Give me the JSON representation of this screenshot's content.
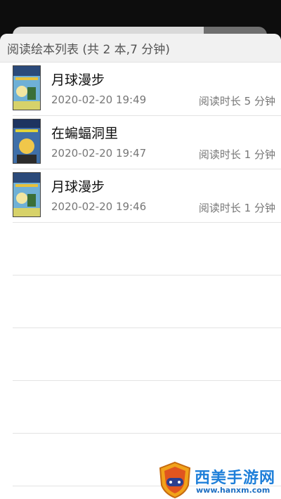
{
  "header": {
    "title": "阅读绘本列表 (共 2 本,7 分钟)"
  },
  "records": [
    {
      "title": "月球漫步",
      "date": "2020-02-20 19:49",
      "duration": "阅读时长 5 分钟",
      "cover": "cover-icon"
    },
    {
      "title": "在蝙蝠洞里",
      "date": "2020-02-20 19:47",
      "duration": "阅读时长 1 分钟",
      "cover": "cover-icon"
    },
    {
      "title": "月球漫步",
      "date": "2020-02-20 19:46",
      "duration": "阅读时长 1 分钟",
      "cover": "cover-icon"
    }
  ],
  "watermark": {
    "title": "西美手游网",
    "url": "www.hanxm.com"
  },
  "colors": {
    "accent": "#1e7fd9",
    "header_bg": "#f1f1f1",
    "text_muted": "#777777"
  }
}
